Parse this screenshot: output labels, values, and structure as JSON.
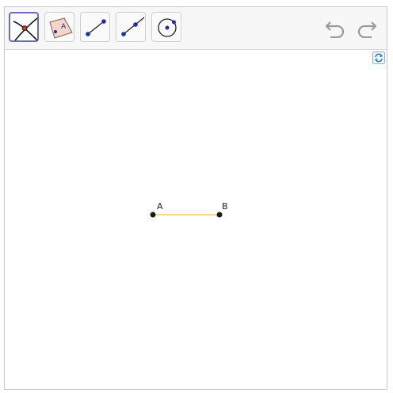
{
  "toolbar": {
    "tools": [
      {
        "name": "intersect-tool",
        "selected": true
      },
      {
        "name": "polygon-point-tool",
        "icon_letter": "A"
      },
      {
        "name": "segment-tool"
      },
      {
        "name": "ray-tool"
      },
      {
        "name": "point-on-object-tool"
      }
    ],
    "undo_icon": "undo-icon",
    "redo_icon": "redo-icon"
  },
  "canvas": {
    "refresh_icon": "refresh-icon",
    "points": [
      {
        "label": "A"
      },
      {
        "label": "B"
      }
    ],
    "segment_color": "#f5c97a",
    "point_color": "#1a1a1a"
  },
  "colors": {
    "selected_border": "#6a6fb3",
    "icon_blue": "#1f2f9c",
    "icon_red": "#c0392b"
  }
}
